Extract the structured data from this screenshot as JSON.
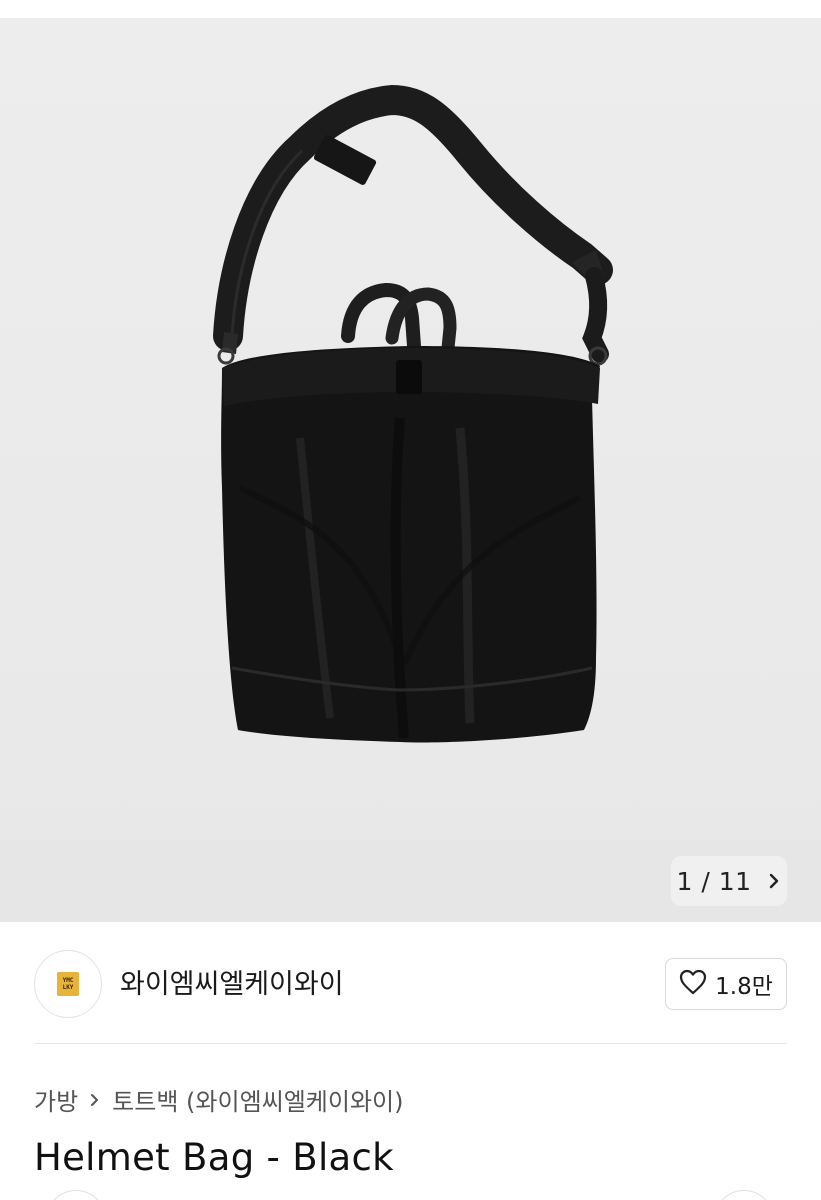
{
  "gallery": {
    "counter_text": "1 / 11",
    "current_index": 1,
    "total": 11,
    "background": "#ececec"
  },
  "brand": {
    "name": "와이엠씨엘케이와이",
    "logo_lines": [
      "YMC",
      "LKY"
    ],
    "logo_color": "#e8b33a"
  },
  "like": {
    "icon": "heart-outline-icon",
    "count": "1.8만"
  },
  "breadcrumb": {
    "items": [
      "가방",
      "토트백 (와이엠씨엘케이와이)"
    ],
    "separator_icon": "chevron-right-icon"
  },
  "product": {
    "title": "Helmet Bag - Black"
  }
}
